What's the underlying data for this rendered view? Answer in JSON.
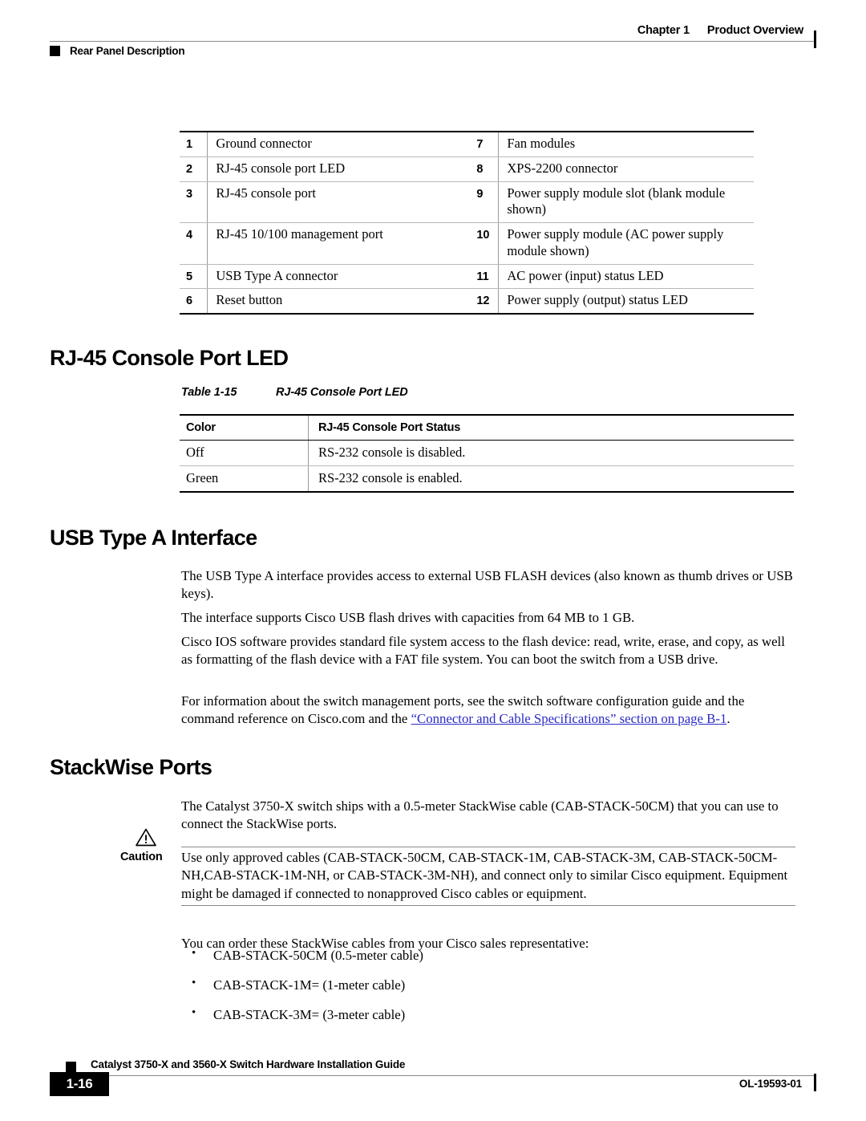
{
  "header": {
    "chapter": "Chapter 1",
    "chapter_title": "Product Overview",
    "running_section": "Rear Panel Description"
  },
  "callout_table": {
    "rows": [
      {
        "num_left": "1",
        "text_left": "Ground connector",
        "num_right": "7",
        "text_right": "Fan modules"
      },
      {
        "num_left": "2",
        "text_left": "RJ-45 console port LED",
        "num_right": "8",
        "text_right": "XPS-2200 connector"
      },
      {
        "num_left": "3",
        "text_left": "RJ-45 console port",
        "num_right": "9",
        "text_right": "Power supply module slot (blank module shown)"
      },
      {
        "num_left": "4",
        "text_left": "RJ-45 10/100 management port",
        "num_right": "10",
        "text_right": "Power supply module (AC power supply module shown)"
      },
      {
        "num_left": "5",
        "text_left": "USB Type A connector",
        "num_right": "11",
        "text_right": "AC power (input) status LED"
      },
      {
        "num_left": "6",
        "text_left": "Reset button",
        "num_right": "12",
        "text_right": "Power supply (output) status LED"
      }
    ]
  },
  "console_led_section": {
    "heading": "RJ-45 Console Port LED",
    "table_caption_number": "Table 1-15",
    "table_caption_title": "RJ-45 Console Port LED",
    "columns": [
      "Color",
      "RJ-45 Console Port Status"
    ],
    "rows": [
      {
        "color": "Off",
        "status": "RS-232 console is disabled."
      },
      {
        "color": "Green",
        "status": "RS-232 console is enabled."
      }
    ]
  },
  "usb_section": {
    "heading": "USB Type A Interface",
    "p1": "The USB Type A interface provides access to external USB FLASH devices (also known as thumb drives or USB keys).",
    "p2": "The interface supports Cisco USB flash drives with capacities from 64 MB to 1 GB.",
    "p3": "Cisco IOS software provides standard file system access to the flash device: read, write, erase, and copy, as well as formatting of the flash device with a FAT file system. You can boot the switch from a USB drive.",
    "p4_before_link": "For information about the switch management ports, see the switch software configuration guide and the command reference on Cisco.com and the ",
    "p4_link": "“Connector and Cable Specifications” section on page B-1",
    "p4_after_link": ".",
    "link_color": "#2b2bc8"
  },
  "stackwise_section": {
    "heading": "StackWise Ports",
    "p1": "The Catalyst 3750-X switch ships with a 0.5-meter StackWise cable (CAB-STACK-50CM) that you can use to connect the StackWise ports.",
    "caution_label": "Caution",
    "caution_text": "Use only approved cables (CAB-STACK-50CM, CAB-STACK-1M, CAB-STACK-3M, CAB-STACK-50CM-NH,CAB-STACK-1M-NH, or CAB-STACK-3M-NH), and connect only to similar Cisco equipment. Equipment might be damaged if connected to nonapproved Cisco cables or equipment.",
    "order_intro": "You can order these StackWise cables from your Cisco sales representative:",
    "cables": [
      "CAB-STACK-50CM (0.5-meter cable)",
      "CAB-STACK-1M= (1-meter cable)",
      "CAB-STACK-3M= (3-meter cable)"
    ]
  },
  "footer": {
    "guide_title": "Catalyst 3750-X and 3560-X Switch Hardware Installation Guide",
    "page_number": "1-16",
    "doc_id": "OL-19593-01"
  }
}
